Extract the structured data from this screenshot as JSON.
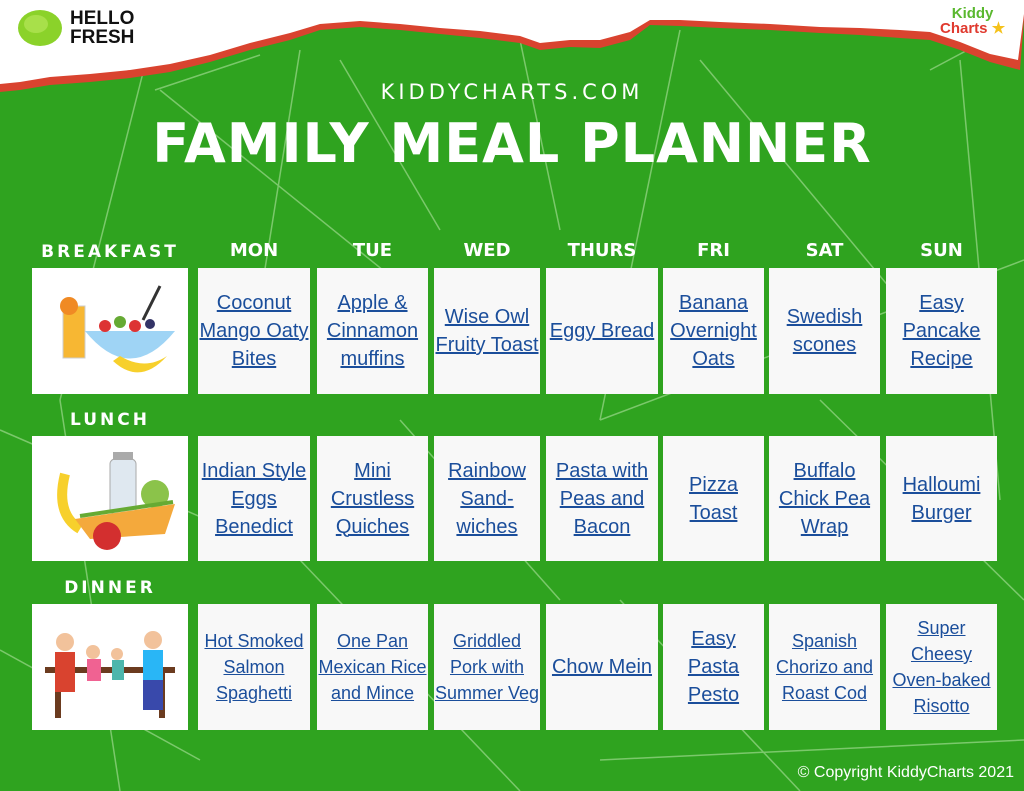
{
  "brand": {
    "hellofresh": "HELLO FRESH",
    "hellofresh_line1": "HELLO",
    "hellofresh_line2": "FRESH",
    "kiddycharts_logo": "KiddyCharts"
  },
  "header": {
    "site": "KIDDYCHARTS.COM",
    "title": "FAMILY MEAL PLANNER"
  },
  "colors": {
    "background": "#2fa31f",
    "torn_edge": "#d9432f",
    "link": "#1b4e9b",
    "cell": "#f8f8f8"
  },
  "days": [
    "MON",
    "TUE",
    "WED",
    "THURS",
    "FRI",
    "SAT",
    "SUN"
  ],
  "meals": [
    {
      "label": "BREAKFAST",
      "icon": "breakfast-bowl-icon",
      "items": [
        "Coconut Mango Oaty Bites",
        "Apple & Cinnamon muffins",
        "Wise Owl Fruity Toast",
        "Eggy Bread",
        "Banana Overnight Oats",
        "Swedish scones",
        "Easy Pancake Recipe"
      ]
    },
    {
      "label": "LUNCH",
      "icon": "lunch-sandwich-icon",
      "items": [
        "Indian Style Eggs Benedict",
        "Mini Crustless Quiches",
        "Rainbow Sand-wiches",
        "Pasta with Peas and Bacon",
        "Pizza Toast",
        "Buffalo Chick Pea Wrap",
        "Halloumi Burger"
      ]
    },
    {
      "label": "DINNER",
      "icon": "family-dinner-icon",
      "items": [
        "Hot Smoked Salmon Spaghetti",
        "One Pan Mexican Rice and Mince",
        "Griddled Pork with Summer Veg",
        "Chow Mein",
        "Easy Pasta Pesto",
        "Spanish Chorizo and Roast Cod",
        "Super Cheesy Oven-baked Risotto"
      ]
    }
  ],
  "footer": {
    "copyright": "© Copyright KiddyCharts 2021"
  }
}
